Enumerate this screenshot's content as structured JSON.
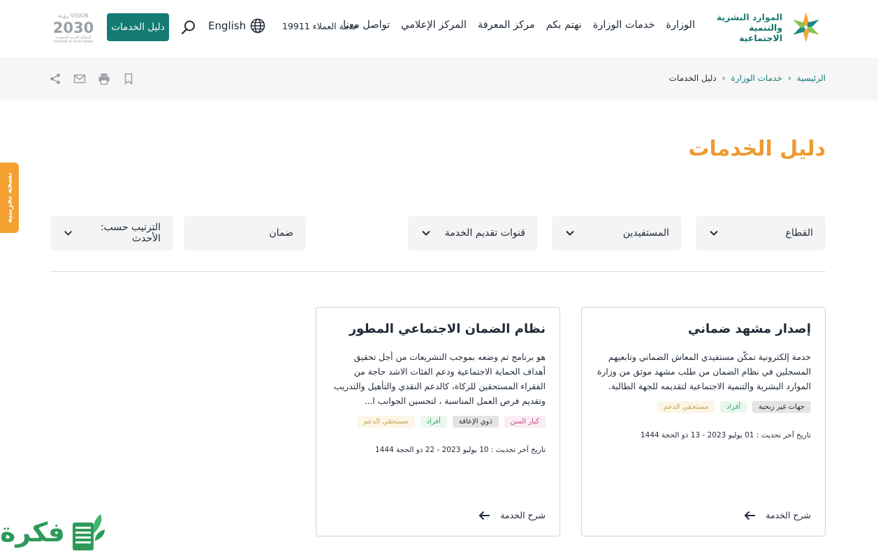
{
  "header": {
    "ministry_logo": {
      "line1": "الموارد البشرية",
      "line2": "والتنمية الاجتماعية"
    },
    "nav": [
      "الوزارة",
      "خدمات الوزارة",
      "نهتم بكم",
      "مركز المعرفة",
      "المركز الإعلامي",
      "تواصل معنا"
    ],
    "customer_service": "خدمة العملاء 19911",
    "language": "English",
    "guide_button": "دليل الخدمات",
    "vision_logo": {
      "top": "VISION رؤيـة",
      "year": "2030",
      "sub": "المملكة العربية السعودية",
      "sub_en": "KINGDOM OF SAUDI ARABIA"
    }
  },
  "breadcrumb": {
    "home": "الرئيسية",
    "services": "خدمات الوزارة",
    "current": "دليل الخدمات"
  },
  "page_title": "دليل الخدمات",
  "beta_tab": "نسخة تجريبية",
  "filters": {
    "sector": "القطاع",
    "beneficiaries": "المستفيدين",
    "channels": "قنوات تقديم الخدمة",
    "search_value": "ضمان",
    "sort": "الترتيب حسب: الأحدث"
  },
  "cards": [
    {
      "title": "إصدار مشهد ضماني",
      "description": "خدمة إلكترونية تمكّن مستفيدي المعاش الضماني وتابعيهم المسجلين في نظام الضمان من طلب مشهد موثق من وزارة الموارد البشرية والتنمية الاجتماعية لتقديمه للجهة الطالبة.",
      "tags": [
        "جهات غير ربحية",
        "أفراد",
        "مستحقي الدعم"
      ],
      "updated": "تاريخ آخر تحديث : 01 يوليو 2023 - 13 ذو الحجة 1444",
      "link": "شرح الخدمة"
    },
    {
      "title": "نظام الضمان الاجتماعي المطور",
      "description": "هو برنامج تم وضعه بموجب التشريعات من أجل تحقيق أهداف الحماية الاجتماعية ودعم الفئات الاشد حاجة من الفقراء المستحقين للزكاة، كالدعم النقدي والتأهيل والتدريب وتقديم فرص العمل المناسبة ، لتحسين الجوانب ا...",
      "tags": [
        "كبار السن",
        "ذوي الإعاقة",
        "أفراد",
        "مستحقي الدعم"
      ],
      "updated": "تاريخ آخر تحديث : 10 يوليو 2023 - 22 ذو الحجة 1444",
      "link": "شرح الخدمة"
    }
  ],
  "watermark": "فكرة",
  "colors": {
    "teal": "#137a74",
    "orange": "#ef9a2e",
    "beta": "#f4a131"
  }
}
